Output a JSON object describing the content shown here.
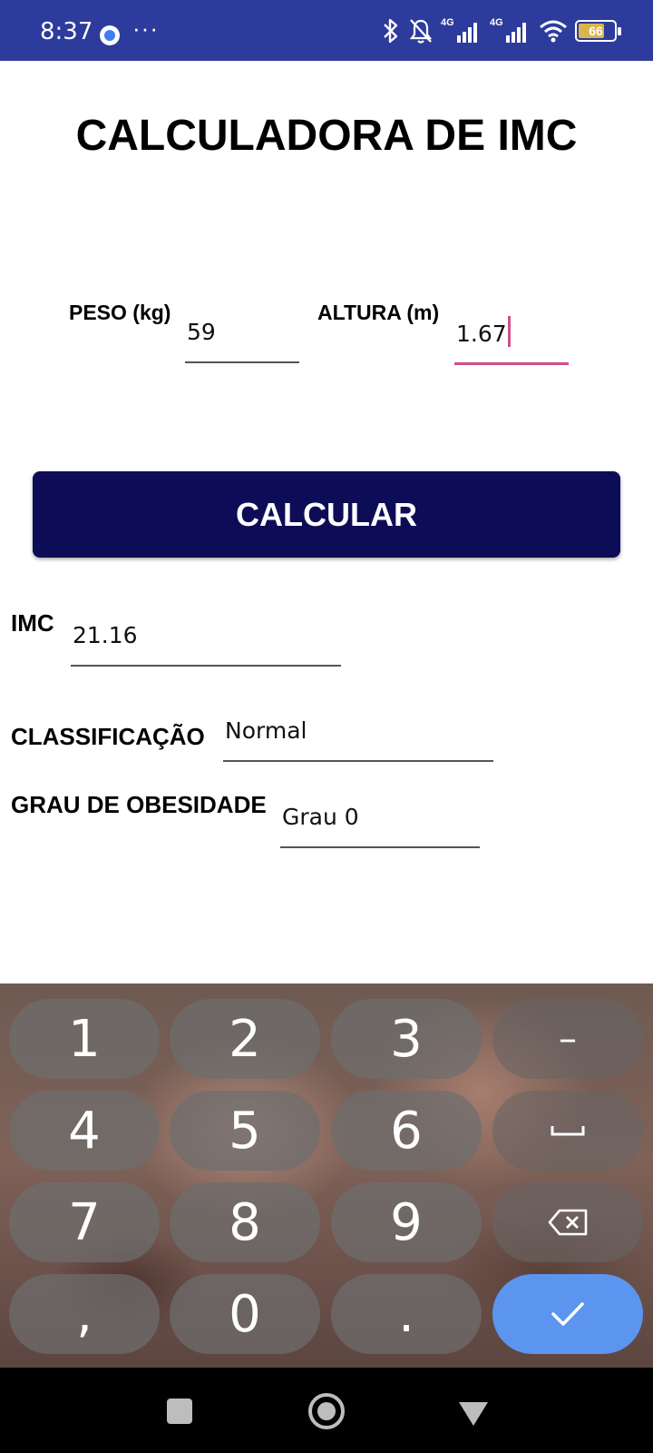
{
  "status_bar": {
    "time": "8:37",
    "more": "···",
    "network_1": "4G",
    "network_2": "4G",
    "battery": "66",
    "battery_level": 0.66,
    "background": "#2d3b9c"
  },
  "title": "CALCULADORA DE IMC",
  "form": {
    "peso_label": "PESO (kg)",
    "peso_value": "59",
    "altura_label": "ALTURA (m)",
    "altura_value": "1.67"
  },
  "calculate_button": "CALCULAR",
  "results": {
    "imc_label": "IMC",
    "imc_value": "21.16",
    "classificacao_label": "CLASSIFICAÇÃO",
    "classificacao_value": "Normal",
    "grau_label": "GRAU DE OBESIDADE",
    "grau_value": "Grau 0"
  },
  "keyboard": {
    "keys": [
      "1",
      "2",
      "3",
      "–",
      "4",
      "5",
      "6",
      "␣",
      "7",
      "8",
      "9",
      "⌫",
      ",",
      "0",
      ".",
      "✓"
    ],
    "key_icons": {
      "space": "space-icon",
      "backspace": "backspace-icon",
      "done": "checkmark-icon"
    }
  },
  "colors": {
    "accent": "#d14f8a",
    "button": "#0d0d57",
    "done_key": "#5b95ef"
  },
  "nav_bar": {
    "icons": [
      "recents-square-icon",
      "home-circle-icon",
      "back-triangle-icon"
    ]
  }
}
